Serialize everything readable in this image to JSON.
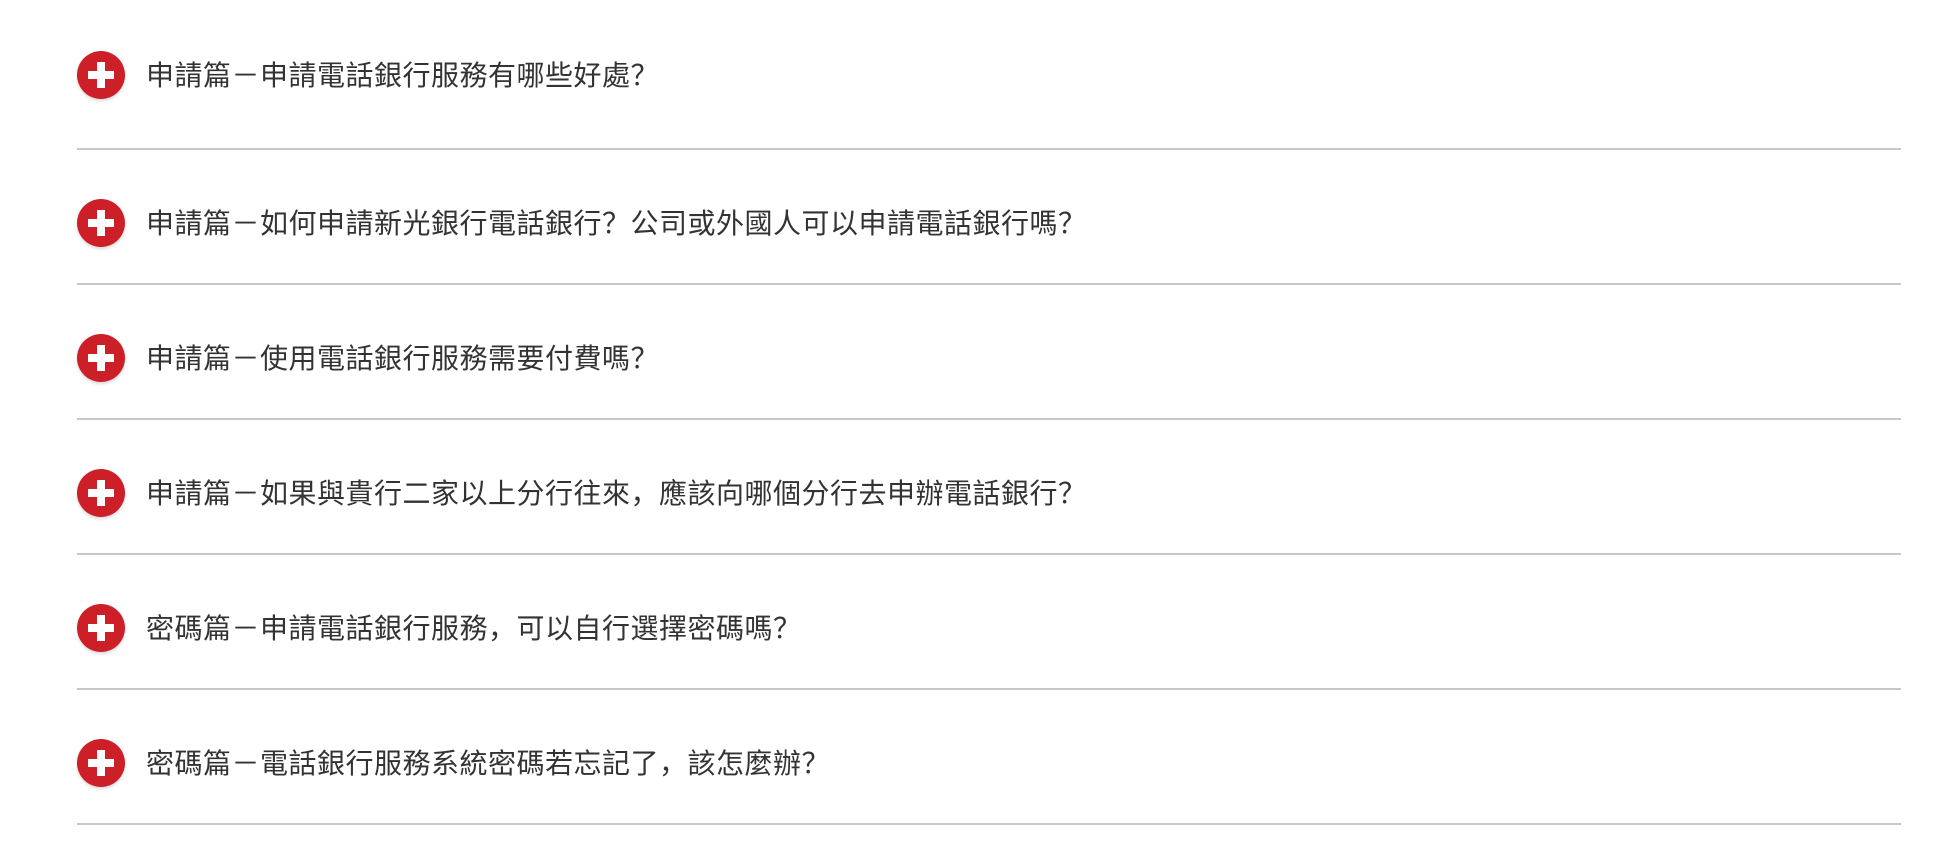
{
  "colors": {
    "accent": "#cc1f27",
    "divider": "#c8c8c8",
    "text": "#333333"
  },
  "faq": {
    "items": [
      {
        "question": "申請篇－申請電話銀行服務有哪些好處？",
        "icon": "plus-circle-icon"
      },
      {
        "question": "申請篇－如何申請新光銀行電話銀行？公司或外國人可以申請電話銀行嗎？",
        "icon": "plus-circle-icon"
      },
      {
        "question": "申請篇－使用電話銀行服務需要付費嗎？",
        "icon": "plus-circle-icon"
      },
      {
        "question": "申請篇－如果與貴行二家以上分行往來，應該向哪個分行去申辦電話銀行？",
        "icon": "plus-circle-icon"
      },
      {
        "question": "密碼篇－申請電話銀行服務，可以自行選擇密碼嗎？",
        "icon": "plus-circle-icon"
      },
      {
        "question": "密碼篇－電話銀行服務系統密碼若忘記了，該怎麼辦？",
        "icon": "plus-circle-icon"
      }
    ]
  }
}
